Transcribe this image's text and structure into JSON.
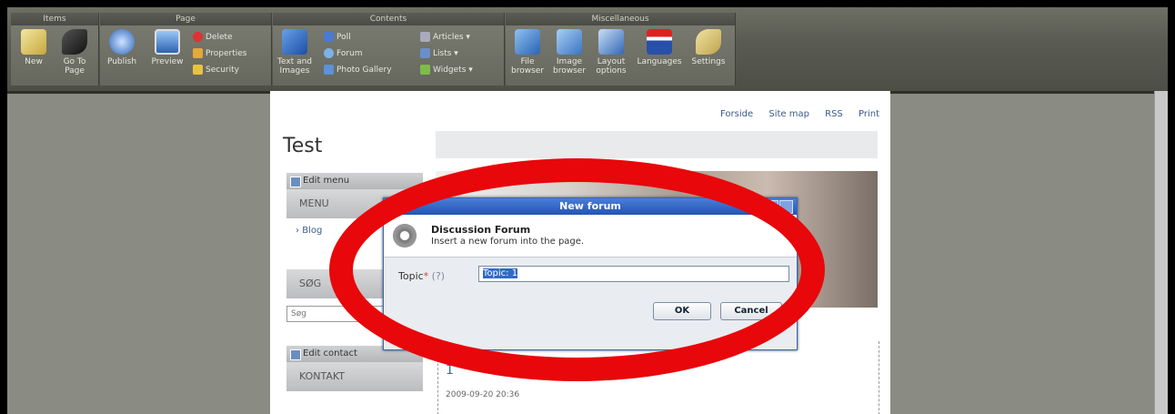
{
  "ribbon": {
    "groups": [
      {
        "title": "Items",
        "buttons": [
          "New",
          "Go To Page"
        ]
      },
      {
        "title": "Page",
        "buttons": [
          "Publish",
          "Preview"
        ],
        "small": [
          "Delete",
          "Properties",
          "Security"
        ]
      },
      {
        "title": "Contents",
        "buttons": [
          "Text and Images"
        ],
        "small": [
          "Poll",
          "Forum",
          "Photo Gallery",
          "Articles",
          "Lists",
          "Widgets"
        ]
      },
      {
        "title": "Miscellaneous",
        "buttons": [
          "File browser",
          "Image browser",
          "Layout options",
          "Languages",
          "Settings"
        ]
      }
    ]
  },
  "page": {
    "toplinks": [
      "Forside",
      "Site map",
      "RSS",
      "Print"
    ],
    "title": "Test",
    "edit_menu": "Edit menu",
    "menu_header": "MENU",
    "menu_item": "Blog",
    "search_header": "SØG",
    "search_placeholder": "Søg",
    "edit_contact": "Edit contact",
    "contact_header": "KONTAKT",
    "post_number": "1",
    "post_date": "2009-09-20 20:36"
  },
  "dialog": {
    "title": "New forum",
    "heading": "Discussion Forum",
    "subheading": "Insert a new forum into the page.",
    "field_label": "Topic",
    "required": "*",
    "help": "(?)",
    "field_value": "Topic: 1",
    "ok": "OK",
    "cancel": "Cancel"
  },
  "colors": {
    "annotation": "#e8070a",
    "dialog_title": "#2354b4"
  }
}
